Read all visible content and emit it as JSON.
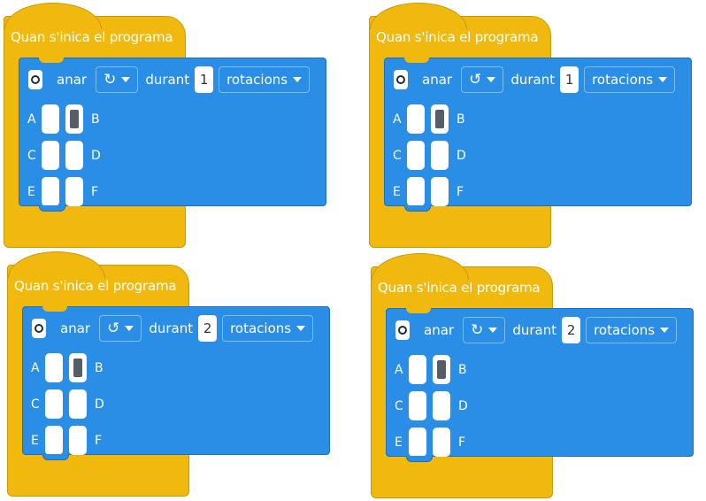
{
  "blocks": [
    {
      "hat_title": "Quan s'inica el programa",
      "action": "anar",
      "direction_icon": "rotate-clockwise-icon",
      "direction_glyph": "↻",
      "during": "durant",
      "count": "1",
      "unit": "rotacions",
      "ports": [
        "A",
        "B",
        "C",
        "D",
        "E",
        "F"
      ],
      "selected_port": "B"
    },
    {
      "hat_title": "Quan s'inica el programa",
      "action": "anar",
      "direction_icon": "rotate-counterclockwise-icon",
      "direction_glyph": "↺",
      "during": "durant",
      "count": "1",
      "unit": "rotacions",
      "ports": [
        "A",
        "B",
        "C",
        "D",
        "E",
        "F"
      ],
      "selected_port": "B"
    },
    {
      "hat_title": "Quan s'inica el programa",
      "action": "anar",
      "direction_icon": "rotate-counterclockwise-icon",
      "direction_glyph": "↺",
      "during": "durant",
      "count": "2",
      "unit": "rotacions",
      "ports": [
        "A",
        "B",
        "C",
        "D",
        "E",
        "F"
      ],
      "selected_port": "B"
    },
    {
      "hat_title": "Quan s'inica el programa",
      "action": "anar",
      "direction_icon": "rotate-clockwise-icon",
      "direction_glyph": "↻",
      "during": "durant",
      "count": "2",
      "unit": "rotacions",
      "ports": [
        "A",
        "B",
        "C",
        "D",
        "E",
        "F"
      ],
      "selected_port": "B"
    }
  ],
  "colors": {
    "hat": "#f1b90d",
    "motor_block": "#2b8ee6",
    "selected_port": "#565d66"
  }
}
